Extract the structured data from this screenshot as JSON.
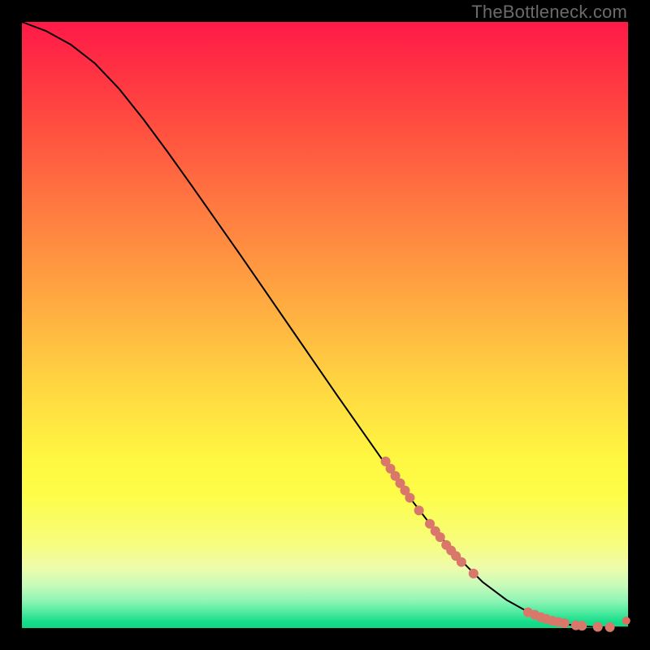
{
  "watermark": "TheBottleneck.com",
  "colors": {
    "page_bg": "#000000",
    "curve": "#000000",
    "dot": "#d9776b",
    "dot_end": "#dd6f5f",
    "gradient_top": "#ff1a48",
    "gradient_bottom": "#0fd784"
  },
  "chart_data": {
    "type": "line",
    "title": "",
    "xlabel": "",
    "ylabel": "",
    "xlim": [
      0,
      100
    ],
    "ylim": [
      0,
      100
    ],
    "grid": false,
    "legend": false,
    "series": [
      {
        "name": "curve",
        "x": [
          0,
          4,
          8,
          12,
          16,
          20,
          24,
          28,
          32,
          36,
          40,
          44,
          48,
          52,
          56,
          60,
          64,
          68,
          72,
          76,
          80,
          84,
          88,
          90,
          92,
          94,
          96,
          98,
          100
        ],
        "y": [
          100,
          98.5,
          96.3,
          93.2,
          89.0,
          84.0,
          78.6,
          73.0,
          67.3,
          61.6,
          55.8,
          50.0,
          44.2,
          38.4,
          32.7,
          27.0,
          21.5,
          16.3,
          11.6,
          7.6,
          4.6,
          2.4,
          1.0,
          0.6,
          0.3,
          0.2,
          0.15,
          0.12,
          0.1
        ]
      }
    ],
    "markers": {
      "name": "highlighted-points",
      "color": "#d9776b",
      "points": [
        {
          "x": 60.0,
          "y": 27.5,
          "r": 6
        },
        {
          "x": 60.8,
          "y": 26.3,
          "r": 6
        },
        {
          "x": 61.6,
          "y": 25.1,
          "r": 6
        },
        {
          "x": 62.4,
          "y": 23.9,
          "r": 6
        },
        {
          "x": 63.2,
          "y": 22.7,
          "r": 6
        },
        {
          "x": 64.0,
          "y": 21.5,
          "r": 6
        },
        {
          "x": 65.5,
          "y": 19.4,
          "r": 6
        },
        {
          "x": 67.3,
          "y": 17.2,
          "r": 6
        },
        {
          "x": 68.2,
          "y": 16.0,
          "r": 6
        },
        {
          "x": 69.0,
          "y": 15.0,
          "r": 6
        },
        {
          "x": 70.0,
          "y": 13.7,
          "r": 6
        },
        {
          "x": 70.8,
          "y": 12.8,
          "r": 6
        },
        {
          "x": 71.6,
          "y": 11.9,
          "r": 6
        },
        {
          "x": 72.5,
          "y": 10.9,
          "r": 6
        },
        {
          "x": 74.5,
          "y": 9.0,
          "r": 6
        },
        {
          "x": 83.5,
          "y": 2.6,
          "r": 6
        },
        {
          "x": 84.6,
          "y": 2.2,
          "r": 6
        },
        {
          "x": 85.6,
          "y": 1.8,
          "r": 6
        },
        {
          "x": 86.5,
          "y": 1.5,
          "r": 6
        },
        {
          "x": 87.5,
          "y": 1.2,
          "r": 6
        },
        {
          "x": 88.5,
          "y": 1.0,
          "r": 6
        },
        {
          "x": 89.5,
          "y": 0.8,
          "r": 6
        },
        {
          "x": 91.4,
          "y": 0.45,
          "r": 6
        },
        {
          "x": 92.4,
          "y": 0.38,
          "r": 6
        },
        {
          "x": 95.0,
          "y": 0.2,
          "r": 6
        },
        {
          "x": 97.0,
          "y": 0.15,
          "r": 6
        },
        {
          "x": 99.7,
          "y": 1.2,
          "r": 5,
          "end": true
        }
      ]
    }
  }
}
